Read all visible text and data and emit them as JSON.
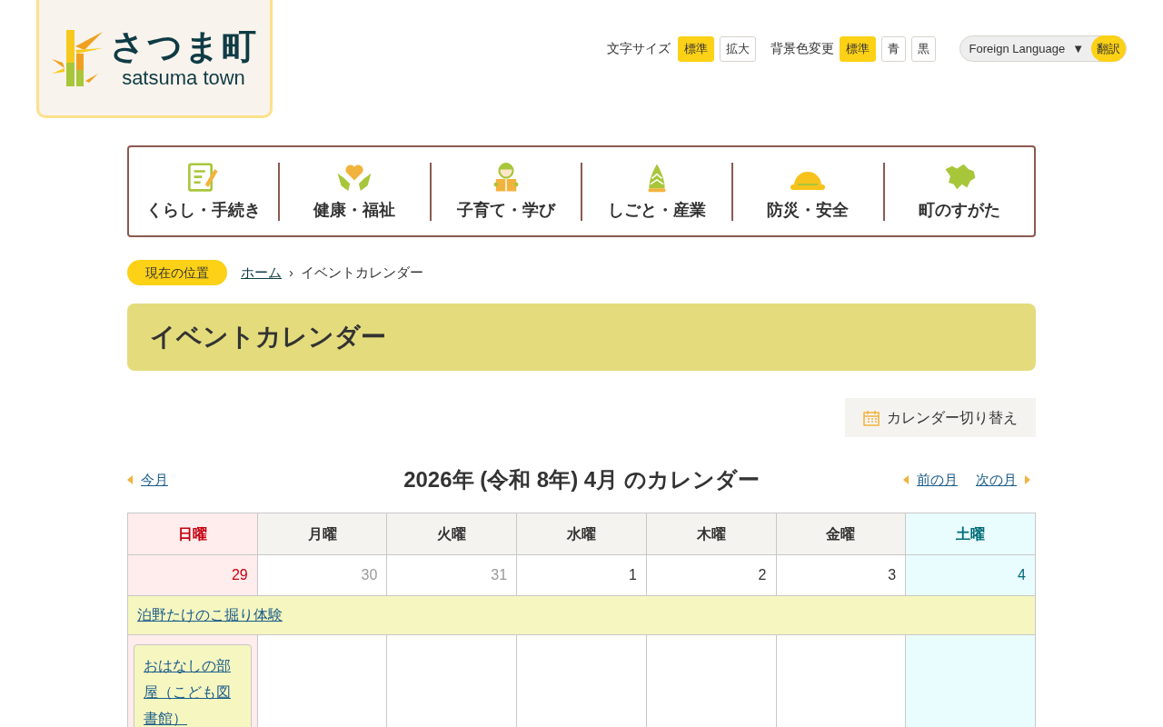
{
  "logo": {
    "title": "さつま町",
    "subtitle": "satsuma town"
  },
  "font_size": {
    "label": "文字サイズ",
    "options": [
      {
        "label": "標準",
        "selected": true
      },
      {
        "label": "拡大",
        "selected": false
      }
    ]
  },
  "bg_color": {
    "label": "背景色変更",
    "options": [
      {
        "label": "標準",
        "selected": true
      },
      {
        "label": "青",
        "selected": false
      },
      {
        "label": "黒",
        "selected": false
      }
    ]
  },
  "language": {
    "select": "Foreign Language",
    "caret": "▼",
    "button": "翻訳"
  },
  "nav": [
    {
      "kind": "form",
      "label": "くらし・手続き"
    },
    {
      "kind": "care",
      "label": "健康・福祉"
    },
    {
      "kind": "child",
      "label": "子育て・学び"
    },
    {
      "kind": "bamboo",
      "label": "しごと・産業"
    },
    {
      "kind": "helmet",
      "label": "防災・安全"
    },
    {
      "kind": "map",
      "label": "町のすがた"
    }
  ],
  "breadcrumb": {
    "badge": "現在の位置",
    "items": [
      {
        "label": "ホーム",
        "link": true
      },
      {
        "label": "イベントカレンダー",
        "link": false
      }
    ],
    "separator": "›"
  },
  "page_title": "イベントカレンダー",
  "switch_button": "カレンダー切り替え",
  "calendar": {
    "this_month": "今月",
    "title": "2026年 (令和 8年) 4月 のカレンダー",
    "prev": "前の月",
    "next": "次の月",
    "weekdays": [
      {
        "kind": "sun",
        "label": "日曜"
      },
      {
        "kind": "weekday",
        "label": "月曜"
      },
      {
        "kind": "weekday",
        "label": "火曜"
      },
      {
        "kind": "weekday",
        "label": "水曜"
      },
      {
        "kind": "weekday",
        "label": "木曜"
      },
      {
        "kind": "weekday",
        "label": "金曜"
      },
      {
        "kind": "sat",
        "label": "土曜"
      }
    ],
    "dates": [
      {
        "kind": "sun",
        "day": "29",
        "in_month": true,
        "events": [
          "おはなしの部屋（こども図書館）"
        ]
      },
      {
        "kind": "weekday",
        "day": "30",
        "in_month": false
      },
      {
        "kind": "weekday",
        "day": "31",
        "in_month": false
      },
      {
        "kind": "weekday",
        "day": "1",
        "in_month": true
      },
      {
        "kind": "weekday",
        "day": "2",
        "in_month": true
      },
      {
        "kind": "weekday",
        "day": "3",
        "in_month": true
      },
      {
        "kind": "sat",
        "day": "4",
        "in_month": true
      }
    ],
    "banner_event": "泊野たけのこ掘り体験"
  }
}
